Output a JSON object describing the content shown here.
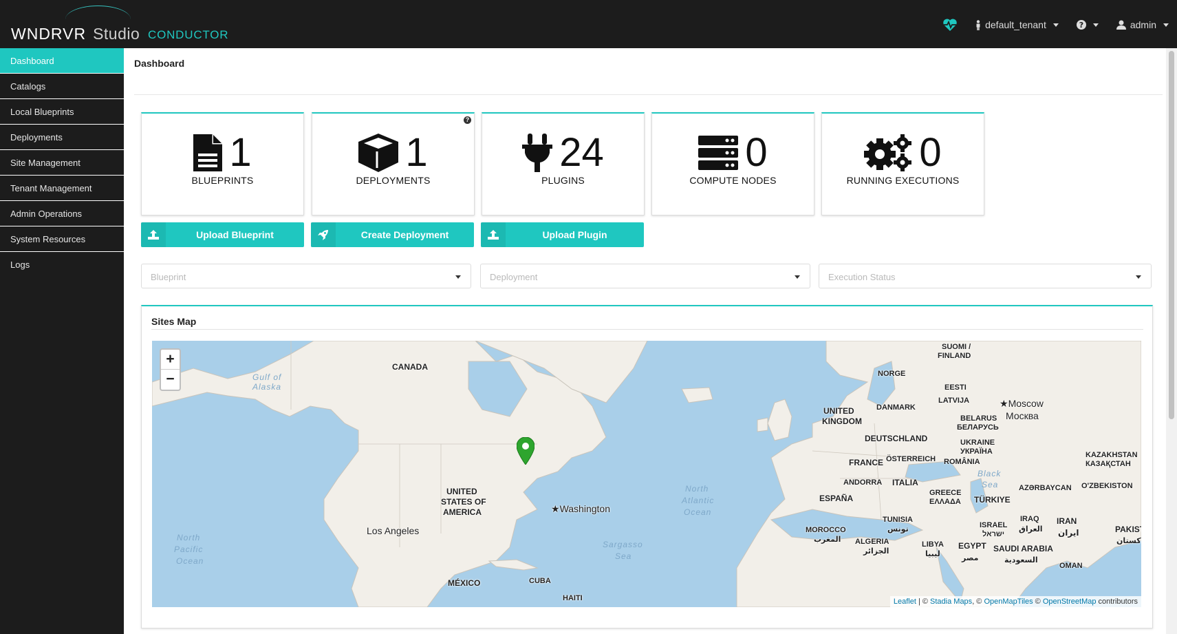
{
  "app": {
    "brand": "WNDRVR",
    "studio": "Studio",
    "product": "CONDUCTOR",
    "accent_color": "#1fc7c0"
  },
  "header": {
    "tenant": "default_tenant",
    "user": "admin",
    "icons": [
      "heartbeat-icon",
      "tenant-icon",
      "help-icon",
      "user-icon"
    ]
  },
  "sidebar": {
    "items": [
      {
        "label": "Dashboard",
        "active": true
      },
      {
        "label": "Catalogs"
      },
      {
        "label": "Local Blueprints"
      },
      {
        "label": "Deployments"
      },
      {
        "label": "Site Management"
      },
      {
        "label": "Tenant Management"
      },
      {
        "label": "Admin Operations"
      },
      {
        "label": "System Resources"
      },
      {
        "label": "Logs"
      }
    ]
  },
  "page": {
    "title": "Dashboard"
  },
  "stats": [
    {
      "value": "1",
      "label": "BLUEPRINTS",
      "icon": "file-icon"
    },
    {
      "value": "1",
      "label": "DEPLOYMENTS",
      "icon": "cube-icon"
    },
    {
      "value": "24",
      "label": "PLUGINS",
      "icon": "plug-icon"
    },
    {
      "value": "0",
      "label": "COMPUTE NODES",
      "icon": "server-icon"
    },
    {
      "value": "0",
      "label": "RUNNING EXECUTIONS",
      "icon": "cogs-icon"
    }
  ],
  "actions": {
    "upload_blueprint": "Upload Blueprint",
    "create_deployment": "Create Deployment",
    "upload_plugin": "Upload Plugin"
  },
  "filters": {
    "blueprint": "Blueprint",
    "deployment": "Deployment",
    "execution_status": "Execution Status"
  },
  "sites_map": {
    "title": "Sites Map",
    "zoom_in": "+",
    "zoom_out": "−",
    "attribution": {
      "leaflet": "Leaflet",
      "sep1": " | © ",
      "stadia": "Stadia Maps",
      "sep2": ", © ",
      "omt": "OpenMapTiles",
      "sep3": " © ",
      "osm": "OpenStreetMap",
      "tail": " contributors"
    },
    "labels": {
      "canada": "CANADA",
      "gulf1": "Gulf of",
      "gulf2": "Alaska",
      "usa1": "UNITED",
      "usa2": "STATES OF",
      "usa3": "AMERICA",
      "washington": "Washington",
      "los_angeles": "Los Angeles",
      "mexico": "MÉXICO",
      "cuba": "CUBA",
      "haiti": "HAITI",
      "npo1": "North",
      "npo2": "Pacific",
      "npo3": "Ocean",
      "nao1": "North",
      "nao2": "Atlantic",
      "nao3": "Ocean",
      "sargasso1": "Sargasso",
      "sargasso2": "Sea",
      "uk1": "UNITED",
      "uk2": "KINGDOM",
      "norge": "NORGE",
      "suomi1": "SUOMI /",
      "suomi2": "FINLAND",
      "danmark": "DANMARK",
      "eesti": "EESTI",
      "latvija": "LATVIJA",
      "moscow1": "Moscow",
      "moscow2": "Москва",
      "belarus1": "BELARUS",
      "belarus2": "БЕЛАРУСЬ",
      "deutschland": "DEUTSCHLAND",
      "ukraine1": "UKRAINE",
      "ukraine2": "УКРАЇНА",
      "france": "FRANCE",
      "osterreich": "ÖSTERREICH",
      "romania": "ROMÂNIA",
      "kazakh1": "KAZAKHSTAN",
      "kazakh2": "КАЗАҚСТАН",
      "andorra": "ANDORRA",
      "italia": "ITALIA",
      "black1": "Black",
      "black2": "Sea",
      "espana": "ESPAÑA",
      "greece1": "GREECE",
      "greece2": "ΕΛΛΑΔΑ",
      "turkiye": "TÜRKIYE",
      "azerbaycan": "AZƏRBAYCAN",
      "ozbekiston": "O'ZBEKISTON",
      "tunisia1": "TUNISIA",
      "tunisia2": "تونس",
      "morocco1": "MOROCCO",
      "morocco2": "المغرب",
      "algeria1": "ALGERIA",
      "algeria2": "الجزائر",
      "israel1": "ISRAEL",
      "israel2": "ישראל",
      "iraq1": "IRAQ",
      "iraq2": "العراق",
      "iran1": "IRAN",
      "iran2": "ایران",
      "pakistan1": "PAKIST",
      "pakistan2": "پاکستان",
      "libya1": "LIBYA",
      "libya2": "ليبيا",
      "egypt1": "EGYPT",
      "egypt2": "مصر",
      "saudi1": "SAUDI ARABIA",
      "saudi2": "السعودية",
      "oman": "OMAN"
    }
  }
}
